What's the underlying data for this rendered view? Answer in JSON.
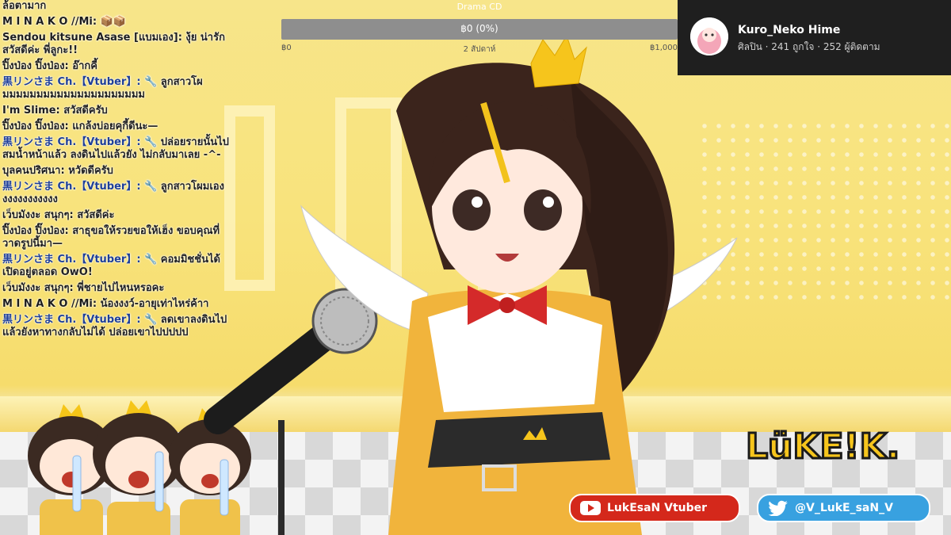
{
  "goal_bar": {
    "title": "Drama CD",
    "progress_text": "฿0 (0%)",
    "progress": 0,
    "min": "฿0",
    "date": "2 สัปดาห์",
    "max": "฿1,000"
  },
  "facebook": {
    "name": "Kuro_Neko Hime",
    "stats": "ศิลปิน · 241 ถูกใจ · 252 ผู้ติดตาม"
  },
  "chat": [
    {
      "author": "",
      "text": "ล้อตามาก",
      "vt": false
    },
    {
      "author": "M I N A K O //Mi:",
      "text": "📦📦",
      "vt": false
    },
    {
      "author": "Sendou kitsune Asase [แบมเอง]:",
      "text": "งุ้ย น่ารัก สวัสดีค่ะ พี่ลูกะ!!",
      "vt": false
    },
    {
      "author": "ปิ๊งป่อง ปิ๊งป่อง:",
      "text": "อ๊ากคี้",
      "vt": false
    },
    {
      "author": "黒リンさま Ch.【Vtuber】:",
      "text": "🔧 ลูกสาวโผ มมมมมมมมมมมมมมมมมมมมม",
      "vt": true
    },
    {
      "author": "I'm Slime:",
      "text": "สวัสดีครับ",
      "vt": false
    },
    {
      "author": "ปิ๊งป่อง ปิ๊งป่อง:",
      "text": "แกล้งบ่อยคุกี้ดีนะ—",
      "vt": false
    },
    {
      "author": "黒リンさま Ch.【Vtuber】:",
      "text": "🔧 ปล่อยรายนั้นไป สมน้ำหน้าแล้ว ลงดินไปแล้วยัง ไม่กลับมาเลย -^-",
      "vt": true
    },
    {
      "author": "บุลคนปริศนา:",
      "text": "หวัดดีครับ",
      "vt": false
    },
    {
      "author": "黒リンさま Ch.【Vtuber】:",
      "text": "🔧 ลูกสาวโผมเอง งงงงงงงงงงง",
      "vt": true
    },
    {
      "author": "เว็บมังงะ สนุกๆ:",
      "text": "สวัสดีค่ะ",
      "vt": false
    },
    {
      "author": "ปิ๊งป่อง ปิ๊งป่อง:",
      "text": "สาธุขอให้รวยขอให้เฮ็ง ขอบคุณที่วาดรูปนี้มา—",
      "vt": false
    },
    {
      "author": "黒リンさま Ch.【Vtuber】:",
      "text": "🔧 คอมมิชชั่นได้ เปิดอยู่ตลอด OwO!",
      "vt": true
    },
    {
      "author": "เว็บมังงะ สนุกๆ:",
      "text": "พี่ชายไปไหนหรอคะ",
      "vt": false
    },
    {
      "author": "M I N A K O //Mi:",
      "text": "น้องงงว์-อายุเท่าไหร่ค้าา",
      "vt": false
    },
    {
      "author": "黒リンさま Ch.【Vtuber】:",
      "text": "🔧 ลดเขาลงดินไป แล้วยังหาทางกลับไม่ได้ ปล่อยเขาไปปปปป",
      "vt": true
    }
  ],
  "socials": {
    "youtube": "LukEsaN Vtuber",
    "twitter": "@V_LukE_saN_V"
  },
  "logo_text": "LüKE!K.",
  "colors": {
    "youtube": "#d4281b",
    "twitter": "#38a1e0",
    "stage": "#f7e58a",
    "facebook_card": "#1f1f1f"
  }
}
